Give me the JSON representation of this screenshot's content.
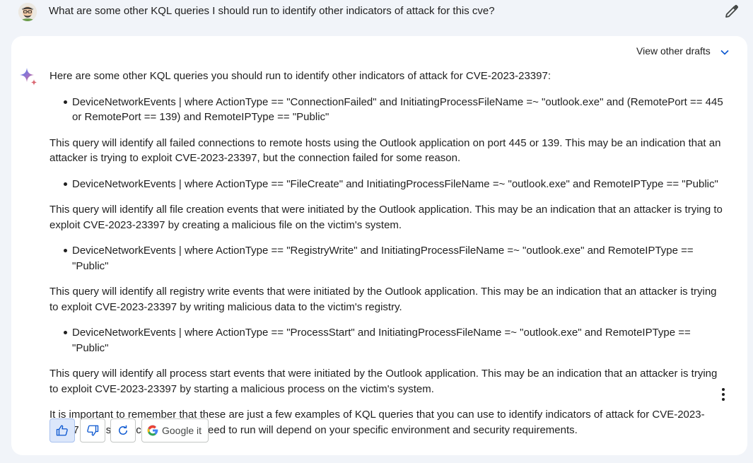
{
  "prompt": {
    "text": "What are some other KQL queries I should run to identify other indicators of attack for this cve?"
  },
  "response": {
    "view_drafts_label": "View other drafts",
    "intro": "Here are some other KQL queries you should run to identify other indicators of attack for CVE-2023-23397:",
    "items": [
      {
        "query": "DeviceNetworkEvents | where ActionType == \"ConnectionFailed\" and InitiatingProcessFileName =~ \"outlook.exe\" and (RemotePort == 445 or RemotePort == 139) and RemoteIPType == \"Public\"",
        "explanation": "This query will identify all failed connections to remote hosts using the Outlook application on port 445 or 139. This may be an indication that an attacker is trying to exploit CVE-2023-23397, but the connection failed for some reason."
      },
      {
        "query": "DeviceNetworkEvents | where ActionType == \"FileCreate\" and InitiatingProcessFileName =~ \"outlook.exe\" and RemoteIPType == \"Public\"",
        "explanation": "This query will identify all file creation events that were initiated by the Outlook application. This may be an indication that an attacker is trying to exploit CVE-2023-23397 by creating a malicious file on the victim's system."
      },
      {
        "query": "DeviceNetworkEvents | where ActionType == \"RegistryWrite\" and InitiatingProcessFileName =~ \"outlook.exe\" and RemoteIPType == \"Public\"",
        "explanation": "This query will identify all registry write events that were initiated by the Outlook application. This may be an indication that an attacker is trying to exploit CVE-2023-23397 by writing malicious data to the victim's registry."
      },
      {
        "query": "DeviceNetworkEvents | where ActionType == \"ProcessStart\" and InitiatingProcessFileName =~ \"outlook.exe\" and RemoteIPType == \"Public\"",
        "explanation": "This query will identify all process start events that were initiated by the Outlook application. This may be an indication that an attacker is trying to exploit CVE-2023-23397 by starting a malicious process on the victim's system."
      }
    ],
    "conclusion": "It is important to remember that these are just a few examples of KQL queries that you can use to identify indicators of attack for CVE-2023-23397. The specific queries you need to run will depend on your specific environment and security requirements."
  },
  "actions": {
    "google_it_label": "Google it"
  },
  "colors": {
    "page_bg": "#f1f4f9",
    "card_bg": "#ffffff",
    "accent_blue": "#0b57d0",
    "thumbs_up_active_bg": "#dce7fb"
  },
  "icons": {
    "edit": "pencil-icon",
    "drafts_toggle": "chevron-down-icon",
    "assistant": "sparkle-icon",
    "like": "thumbs-up-icon",
    "dislike": "thumbs-down-icon",
    "regenerate": "refresh-icon",
    "search": "google-g-icon",
    "menu": "more-vert-icon"
  }
}
